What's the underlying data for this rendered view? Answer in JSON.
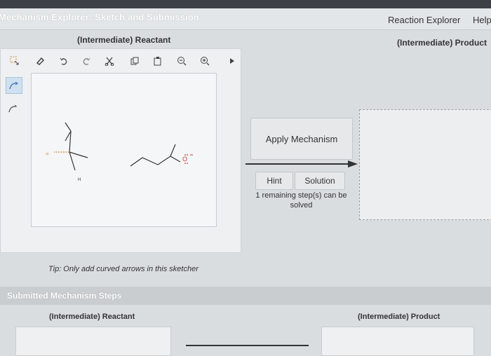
{
  "header": {
    "title": "Mechanism Explorer: Sketch and Submission",
    "reaction_explorer": "Reaction Explorer",
    "help": "Help"
  },
  "reactant_label": "(Intermediate) Reactant",
  "product_label": "(Intermediate) Product",
  "toolbar": {
    "icons": [
      "lasso-select-icon",
      "eraser-icon",
      "undo-icon",
      "redo-icon",
      "cut-icon",
      "copy-icon",
      "paste-icon",
      "zoom-out-icon",
      "zoom-in-icon",
      "more-arrow-icon"
    ]
  },
  "side_tools": [
    "curved-arrow-pair-icon",
    "curved-arrow-single-icon"
  ],
  "molecule": {
    "atom_h": "H",
    "atom_o": "O"
  },
  "tip": "Tip: Only add curved arrows in this sketcher",
  "apply_button": "Apply Mechanism",
  "hint_button": "Hint",
  "solution_button": "Solution",
  "remaining_text": "1 remaining step(s) can be solved",
  "submitted": {
    "title": "Submitted Mechanism Steps",
    "reactant_label": "(Intermediate) Reactant",
    "product_label": "(Intermediate) Product"
  }
}
